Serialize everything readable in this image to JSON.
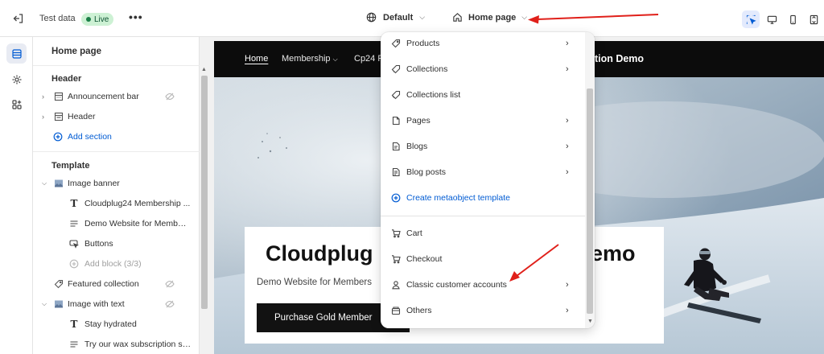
{
  "topbar": {
    "test_data": "Test data",
    "live_badge": "Live",
    "more": "•••",
    "theme_select": "Default",
    "page_select": "Home page"
  },
  "panel": {
    "title": "Home page",
    "header_group": "Header",
    "header_items": [
      {
        "label": "Announcement bar"
      },
      {
        "label": "Header"
      }
    ],
    "add_section": "Add section",
    "template_group": "Template",
    "template_items": [
      {
        "label": "Image banner"
      },
      {
        "label": "Cloudplug24 Membership ..."
      },
      {
        "label": "Demo Website for Member..."
      },
      {
        "label": "Buttons"
      },
      {
        "label": "Add block (3/3)"
      },
      {
        "label": "Featured collection"
      },
      {
        "label": "Image with text"
      },
      {
        "label": "Stay hydrated"
      },
      {
        "label": "Try our wax subscription so..."
      }
    ]
  },
  "preview": {
    "nav": [
      "Home",
      "Membership",
      "Cp24 F"
    ],
    "brand": "ction Demo",
    "hero_title_left": "Cloudplug",
    "hero_title_right": "emo",
    "hero_subtitle": "Demo Website for Members",
    "hero_button": "Purchase Gold Member"
  },
  "dropdown": {
    "items": [
      {
        "label": "Products",
        "icon": "tag-icon",
        "arrow": true
      },
      {
        "label": "Collections",
        "icon": "collection-icon",
        "arrow": true
      },
      {
        "label": "Collections list",
        "icon": "collection-list-icon",
        "arrow": false
      },
      {
        "label": "Pages",
        "icon": "page-icon",
        "arrow": true
      },
      {
        "label": "Blogs",
        "icon": "blog-icon",
        "arrow": true
      },
      {
        "label": "Blog posts",
        "icon": "blog-post-icon",
        "arrow": true
      },
      {
        "label": "Create metaobject template",
        "icon": "plus-circle-icon",
        "arrow": false,
        "accent": true
      },
      {
        "label": "Cart",
        "icon": "cart-icon",
        "arrow": false
      },
      {
        "label": "Checkout",
        "icon": "checkout-icon",
        "arrow": false
      },
      {
        "label": "Classic customer accounts",
        "icon": "person-icon",
        "arrow": true
      },
      {
        "label": "Others",
        "icon": "others-icon",
        "arrow": true
      }
    ]
  },
  "colors": {
    "accent": "#005bd3",
    "live_green": "#1a7f46",
    "annotation_red": "#e0201a"
  }
}
